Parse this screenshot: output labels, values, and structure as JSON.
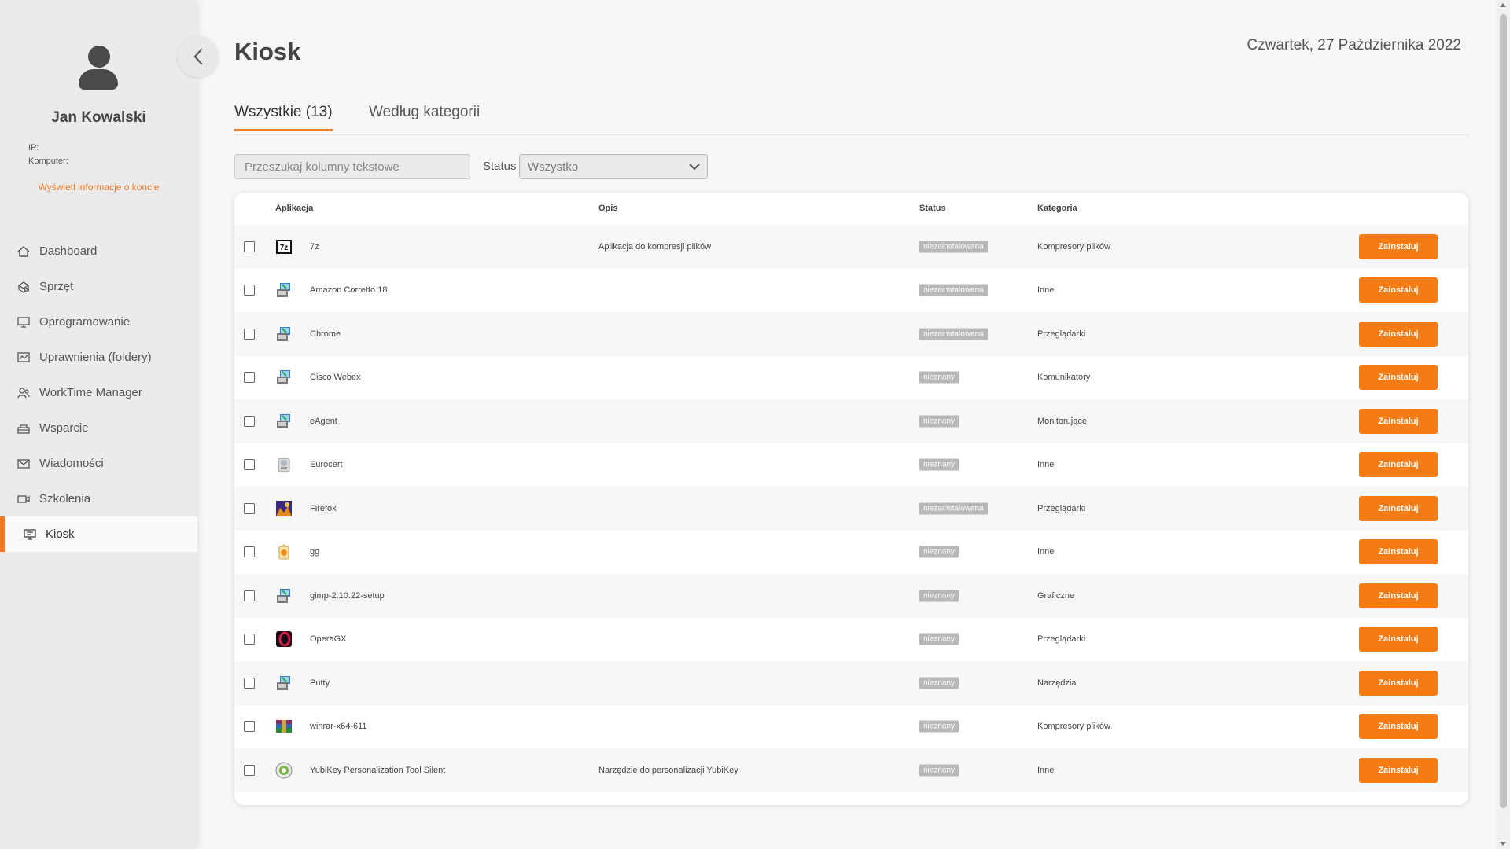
{
  "sidebar": {
    "user_name": "Jan Kowalski",
    "ip_label": "IP:",
    "computer_label": "Komputer:",
    "account_link": "Wyświetl informacje o koncie",
    "items": [
      {
        "label": "Dashboard",
        "icon": "home-icon"
      },
      {
        "label": "Sprzęt",
        "icon": "hardware-icon"
      },
      {
        "label": "Oprogramowanie",
        "icon": "monitor-icon"
      },
      {
        "label": "Uprawnienia (foldery)",
        "icon": "permissions-icon"
      },
      {
        "label": "WorkTime Manager",
        "icon": "users-icon"
      },
      {
        "label": "Wsparcie",
        "icon": "support-icon"
      },
      {
        "label": "Wiadomości",
        "icon": "mail-icon"
      },
      {
        "label": "Szkolenia",
        "icon": "video-icon"
      },
      {
        "label": "Kiosk",
        "icon": "kiosk-icon",
        "active": true
      }
    ]
  },
  "header": {
    "title": "Kiosk",
    "date": "Czwartek, 27 Października 2022"
  },
  "tabs": [
    {
      "label": "Wszystkie (13)",
      "active": true
    },
    {
      "label": "Według kategorii",
      "active": false
    }
  ],
  "filters": {
    "search_placeholder": "Przeszukaj kolumny tekstowe",
    "status_label": "Status",
    "status_value": "Wszystko"
  },
  "table": {
    "headers": {
      "app": "Aplikacja",
      "desc": "Opis",
      "status": "Status",
      "category": "Kategoria"
    },
    "install_label": "Zainstaluj",
    "rows": [
      {
        "name": "7z",
        "desc": "Aplikacja do kompresji plików",
        "status": "niezainstalowana",
        "category": "Kompresory plików",
        "icon": "7z-icon"
      },
      {
        "name": "Amazon Corretto 18",
        "desc": "",
        "status": "niezainstalowana",
        "category": "Inne",
        "icon": "installer-icon"
      },
      {
        "name": "Chrome",
        "desc": "",
        "status": "niezainstalowana",
        "category": "Przeglądarki",
        "icon": "installer-icon"
      },
      {
        "name": "Cisco Webex",
        "desc": "",
        "status": "nieznany",
        "category": "Komunikatory",
        "icon": "installer-icon"
      },
      {
        "name": "eAgent",
        "desc": "",
        "status": "nieznany",
        "category": "Monitorujące",
        "icon": "installer-icon"
      },
      {
        "name": "Eurocert",
        "desc": "",
        "status": "nieznany",
        "category": "Inne",
        "icon": "eurocert-icon"
      },
      {
        "name": "Firefox",
        "desc": "",
        "status": "niezainstalowana",
        "category": "Przeglądarki",
        "icon": "firefox-icon"
      },
      {
        "name": "gg",
        "desc": "",
        "status": "nieznany",
        "category": "Inne",
        "icon": "gg-icon"
      },
      {
        "name": "gimp-2.10.22-setup",
        "desc": "",
        "status": "nieznany",
        "category": "Graficzne",
        "icon": "installer-icon"
      },
      {
        "name": "OperaGX",
        "desc": "",
        "status": "nieznany",
        "category": "Przeglądarki",
        "icon": "operagx-icon"
      },
      {
        "name": "Putty",
        "desc": "",
        "status": "nieznany",
        "category": "Narzędzia",
        "icon": "installer-icon"
      },
      {
        "name": "winrar-x64-611",
        "desc": "",
        "status": "nieznany",
        "category": "Kompresory plików",
        "icon": "winrar-icon"
      },
      {
        "name": "YubiKey Personalization Tool Silent",
        "desc": "Narzędzie do personalizacji YubiKey",
        "status": "nieznany",
        "category": "Inne",
        "icon": "yubikey-icon"
      }
    ]
  },
  "colors": {
    "accent": "#f07b24",
    "install_button": "#f57c14",
    "badge": "#b8b8b8"
  }
}
